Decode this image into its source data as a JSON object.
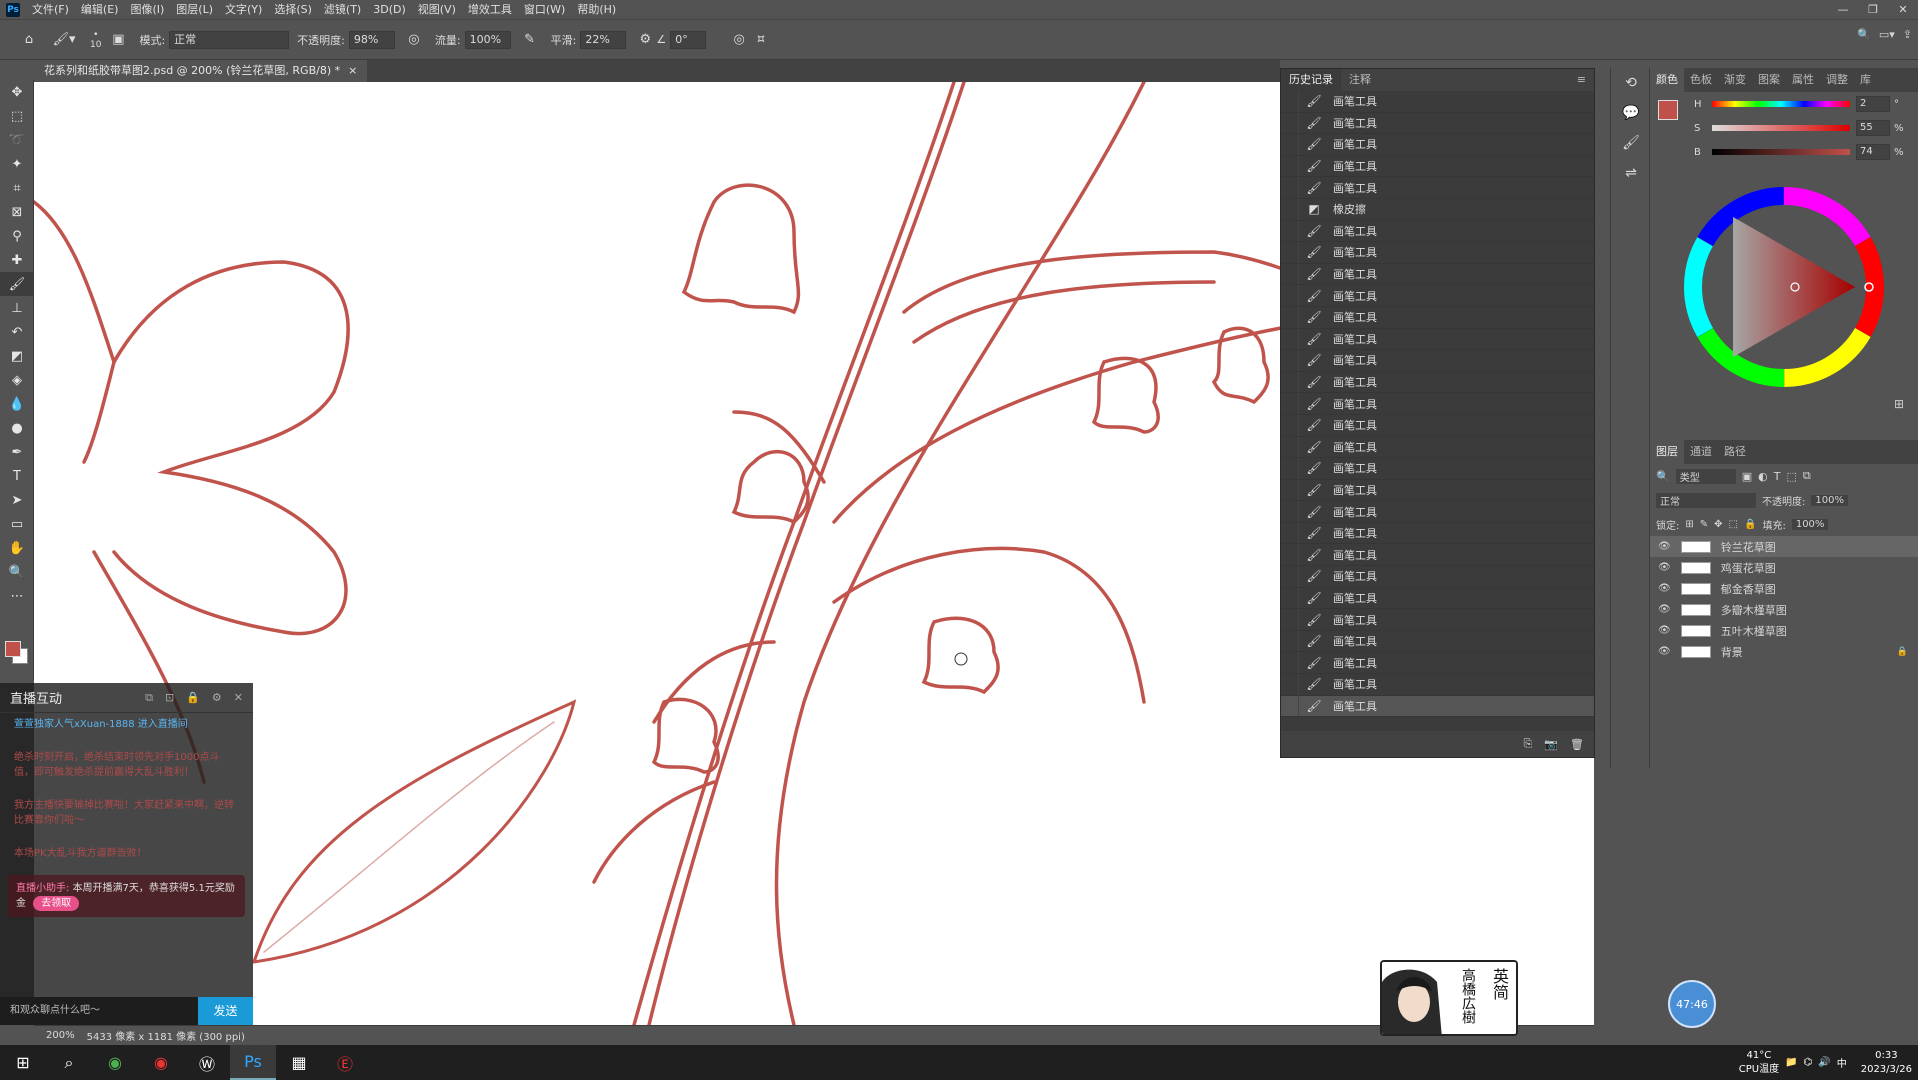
{
  "menubar": {
    "items": [
      "文件(F)",
      "编辑(E)",
      "图像(I)",
      "图层(L)",
      "文字(Y)",
      "选择(S)",
      "滤镜(T)",
      "3D(D)",
      "视图(V)",
      "增效工具",
      "窗口(W)",
      "帮助(H)"
    ]
  },
  "options": {
    "brush_size": "10",
    "mode_label": "模式:",
    "mode_value": "正常",
    "opacity_label": "不透明度:",
    "opacity_value": "98%",
    "flow_label": "流量:",
    "flow_value": "100%",
    "smooth_label": "平滑:",
    "smooth_value": "22%",
    "angle_value": "0°"
  },
  "document": {
    "tab_title": "花系列和纸胶带草图2.psd @ 200% (铃兰花草图, RGB/8) *",
    "zoom": "200%",
    "dimensions": "5433 像素 x 1181 像素 (300 ppi)"
  },
  "history": {
    "tabs": [
      "历史记录",
      "注释"
    ],
    "items": [
      "画笔工具",
      "画笔工具",
      "画笔工具",
      "画笔工具",
      "画笔工具",
      "橡皮擦",
      "画笔工具",
      "画笔工具",
      "画笔工具",
      "画笔工具",
      "画笔工具",
      "画笔工具",
      "画笔工具",
      "画笔工具",
      "画笔工具",
      "画笔工具",
      "画笔工具",
      "画笔工具",
      "画笔工具",
      "画笔工具",
      "画笔工具",
      "画笔工具",
      "画笔工具",
      "画笔工具",
      "画笔工具",
      "画笔工具",
      "画笔工具",
      "画笔工具",
      "画笔工具"
    ]
  },
  "color_panel": {
    "tabs": [
      "颜色",
      "色板",
      "渐变",
      "图案",
      "属性",
      "调整",
      "库"
    ],
    "h_label": "H",
    "h_value": "2",
    "h_unit": "°",
    "s_label": "S",
    "s_value": "55",
    "s_unit": "%",
    "b_label": "B",
    "b_value": "74",
    "b_unit": "%",
    "fg_color": "#c0514a",
    "s_fraction": 0.55,
    "b_fraction": 0.74
  },
  "layers_panel": {
    "tabs": [
      "图层",
      "通道",
      "路径"
    ],
    "filter_label": "类型",
    "blend_mode": "正常",
    "opacity_label": "不透明度:",
    "opacity_value": "100%",
    "lock_label": "锁定:",
    "fill_label": "填充:",
    "fill_value": "100%",
    "layers": [
      "铃兰花草图",
      "鸡蛋花草图",
      "郁金香草图",
      "多瓣木槿草图",
      "五叶木槿草图",
      "背景"
    ]
  },
  "live_panel": {
    "title": "直播互动",
    "welcome": "萱萱独家人气xXuan-1888 进入直播间",
    "msg1": "绝杀时刻开启，绝杀结束时领先对手1000点斗值，即可触发绝杀提前赢得大乱斗胜利！",
    "msg2": "我方主播快要输掉比赛啦！大家赶紧来中啊，逆转比赛靠你们啦～",
    "msg3": "本场PK大乱斗我方道群告败！",
    "notice_prefix": "直播小助手:",
    "notice_text": "本周开播满7天，恭喜获得5.1元奖励金",
    "notice_button": "去领取",
    "input_placeholder": "和观众聊点什么吧～",
    "send_label": "发送"
  },
  "badge": {
    "name_main": "高橋広樹",
    "name_small": "英简"
  },
  "timer": "47:46",
  "taskbar": {
    "temp": "41°C",
    "temp_label": "CPU温度",
    "time": "0:33",
    "date": "2023/3/26"
  }
}
